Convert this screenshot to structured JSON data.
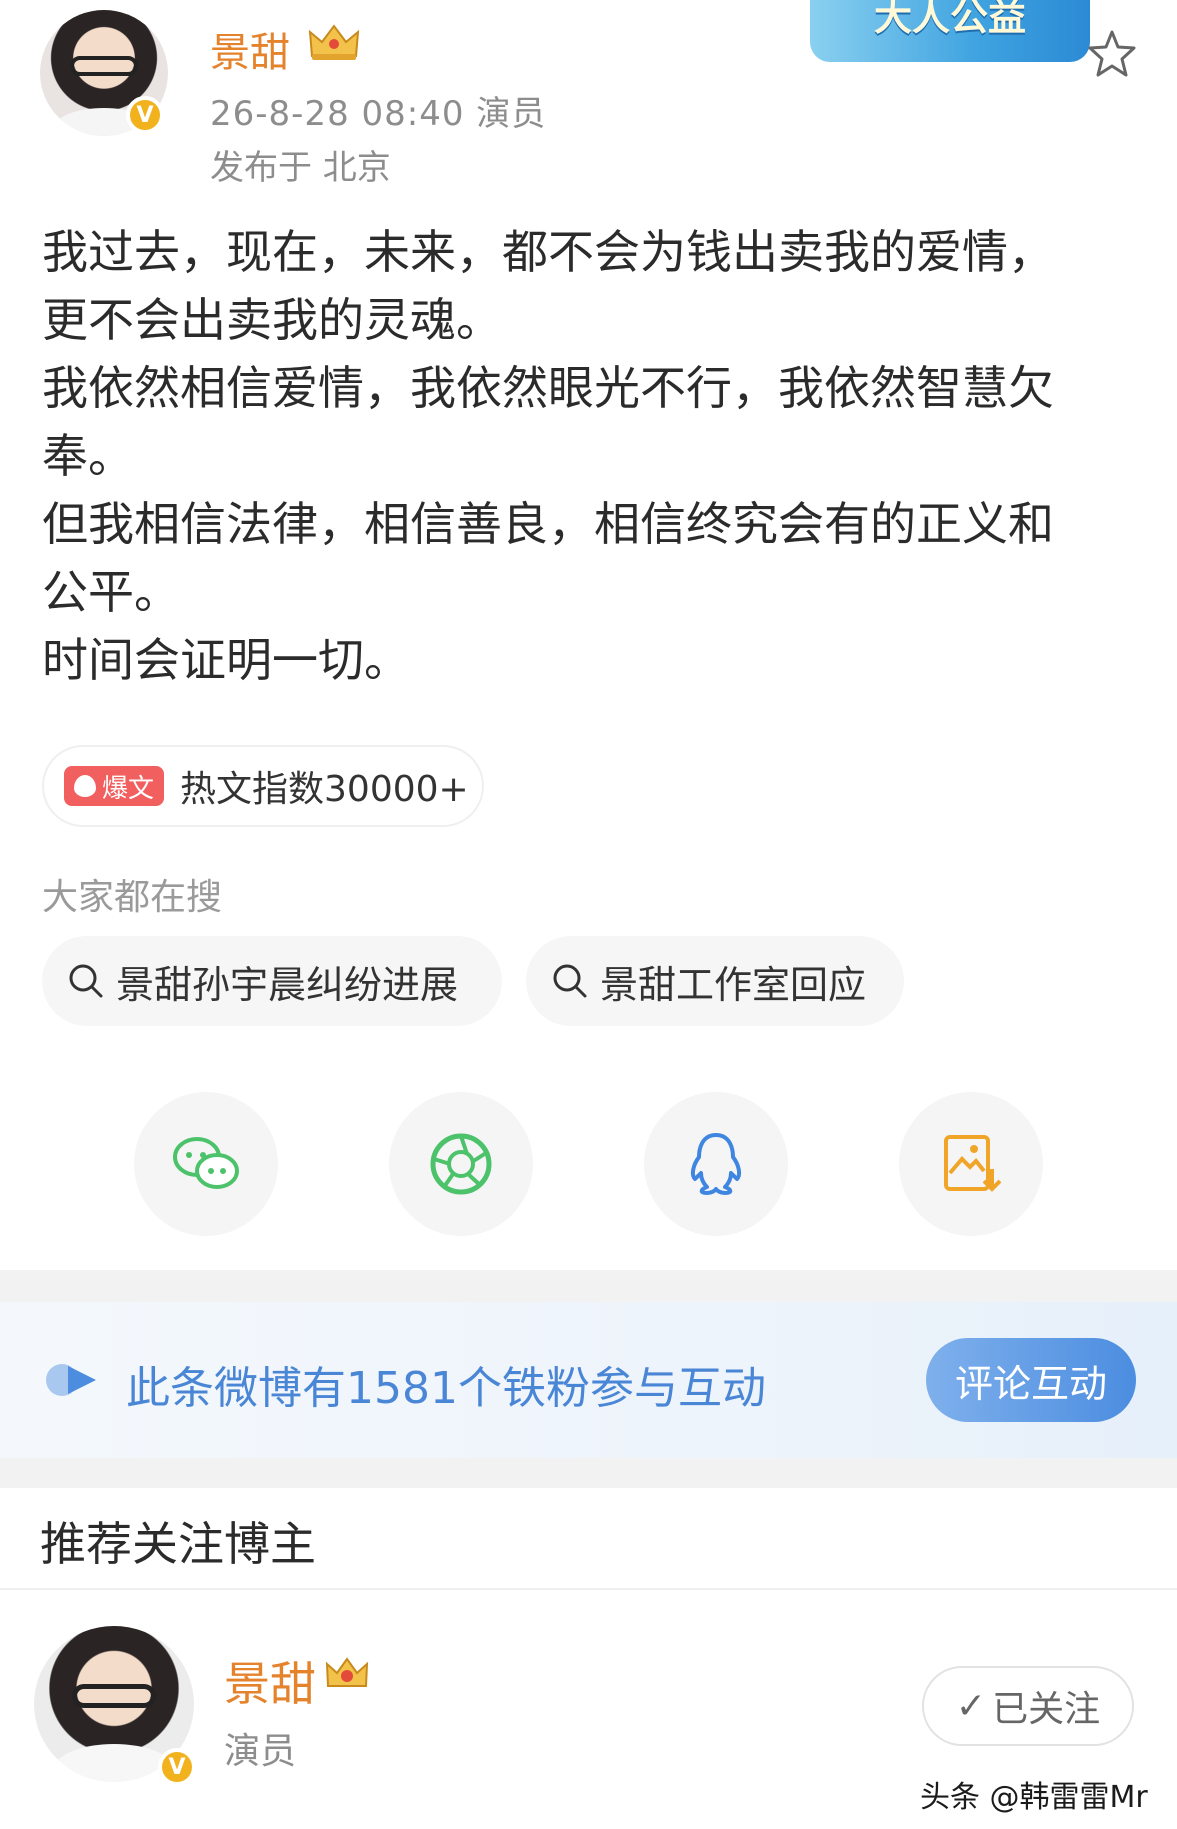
{
  "post": {
    "author": "景甜",
    "time_role": "26-8-28 08:40  演员",
    "location": "发布于 北京",
    "banner_text": "大人公益",
    "text_lines": [
      "我过去，现在，未来，都不会为钱出卖我的爱情，",
      "更不会出卖我的灵魂。",
      "我依然相信爱情，我依然眼光不行，我依然智慧欠",
      "奉。",
      "但我相信法律，相信善良，相信终究会有的正义和",
      "公平。",
      "时间会证明一切。"
    ]
  },
  "hot": {
    "tag": "爆文",
    "text": "热文指数30000+"
  },
  "search": {
    "title": "大家都在搜",
    "chips": [
      "景甜孙宇晨纠纷进展",
      "景甜工作室回应"
    ]
  },
  "share": {
    "icons": [
      "wechat-icon",
      "moments-icon",
      "qq-icon",
      "save-image-icon"
    ],
    "colors": {
      "wechat": "#4cc26a",
      "moments": "#4cc26a",
      "qq": "#3f86e0",
      "save": "#f0a529"
    }
  },
  "fans": {
    "text": "此条微博有1581个铁粉参与互动",
    "button": "评论互动"
  },
  "recommend": {
    "title": "推荐关注博主",
    "name": "景甜",
    "role": "演员",
    "follow_label": "已关注",
    "check": "✓"
  },
  "badge_letter": "V",
  "watermark": "头条 @韩雷雷Mr",
  "colors": {
    "username": "#e5822c",
    "accent_blue": "#4a86d6",
    "hot_red": "#f25f5f",
    "verified": "#f2b21e"
  }
}
